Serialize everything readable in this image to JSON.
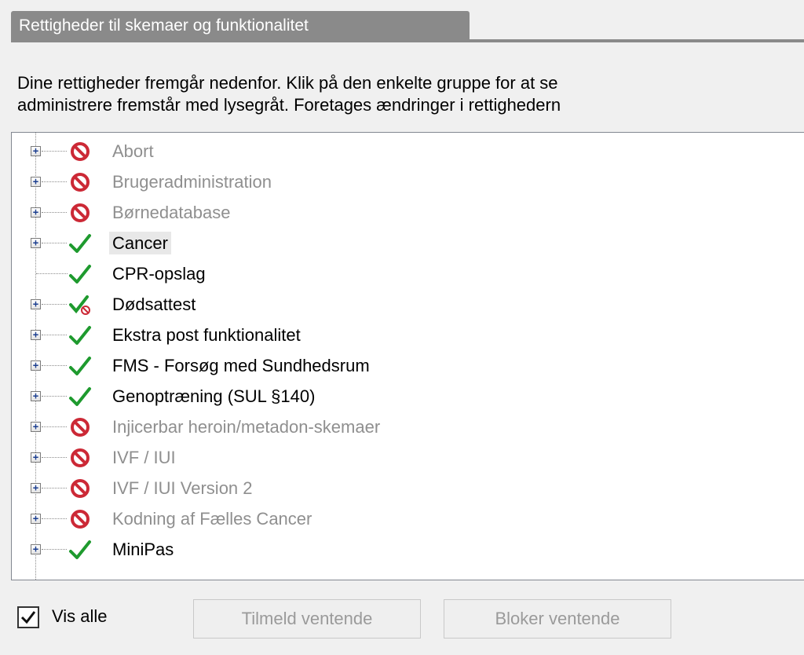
{
  "group": {
    "title": "Rettigheder til skemaer og funktionalitet"
  },
  "description": {
    "line1": "Dine rettigheder fremgår nedenfor. Klik på den enkelte gruppe for at se",
    "line2": "administrere fremstår med lysegråt. Foretages ændringer i rettighedern"
  },
  "tree": {
    "items": [
      {
        "label": "Abort",
        "status": "blocked",
        "enabled": false,
        "expandable": true
      },
      {
        "label": "Brugeradministration",
        "status": "blocked",
        "enabled": false,
        "expandable": true
      },
      {
        "label": "Børnedatabase",
        "status": "blocked",
        "enabled": false,
        "expandable": true
      },
      {
        "label": "Cancer",
        "status": "granted",
        "enabled": true,
        "expandable": true,
        "selected": true
      },
      {
        "label": "CPR-opslag",
        "status": "granted",
        "enabled": true,
        "expandable": false
      },
      {
        "label": "Dødsattest",
        "status": "partial",
        "enabled": true,
        "expandable": true
      },
      {
        "label": "Ekstra post funktionalitet",
        "status": "granted",
        "enabled": true,
        "expandable": true
      },
      {
        "label": "FMS - Forsøg med Sundhedsrum",
        "status": "granted",
        "enabled": true,
        "expandable": true
      },
      {
        "label": "Genoptræning (SUL §140)",
        "status": "granted",
        "enabled": true,
        "expandable": true
      },
      {
        "label": "Injicerbar heroin/metadon-skemaer",
        "status": "blocked",
        "enabled": false,
        "expandable": true
      },
      {
        "label": "IVF / IUI",
        "status": "blocked",
        "enabled": false,
        "expandable": true
      },
      {
        "label": "IVF / IUI Version 2",
        "status": "blocked",
        "enabled": false,
        "expandable": true
      },
      {
        "label": "Kodning af Fælles Cancer",
        "status": "blocked",
        "enabled": false,
        "expandable": true
      },
      {
        "label": "MiniPas",
        "status": "granted",
        "enabled": true,
        "expandable": true
      }
    ]
  },
  "controls": {
    "show_all_label": "Vis alle",
    "show_all_checked": true,
    "enroll_pending_label": "Tilmeld ventende",
    "block_pending_label": "Bloker ventende"
  },
  "icons": {
    "granted": "checkmark-icon",
    "blocked": "prohibited-icon",
    "partial": "partial-checkmark-icon",
    "expand": "plus-expander-icon"
  },
  "colors": {
    "granted": "#1e9a2e",
    "blocked": "#cc2936",
    "disabled_text": "#8f8f8f",
    "group_header": "#8a8a8a"
  }
}
